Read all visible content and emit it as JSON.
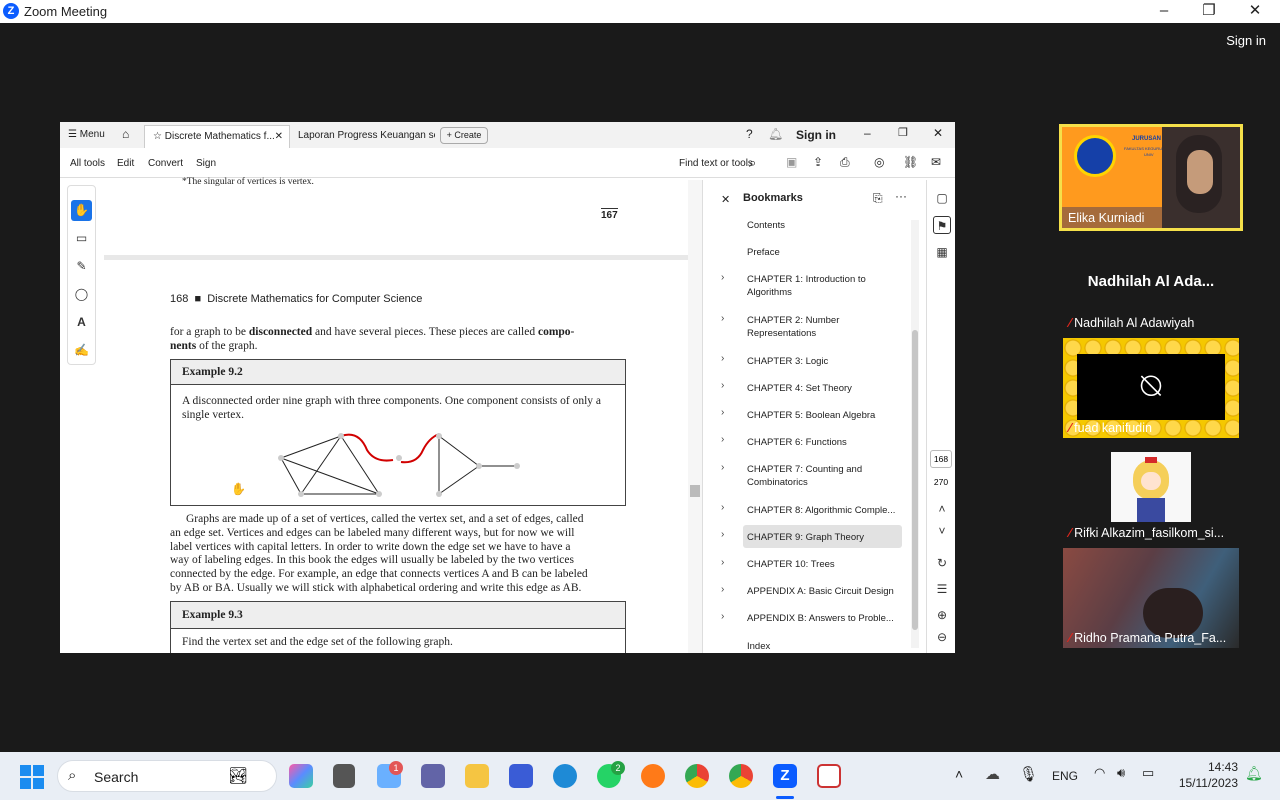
{
  "zoom": {
    "title": "Zoom Meeting",
    "sign_in": "Sign in"
  },
  "acrobat": {
    "tabs": [
      "Menu",
      "Discrete Mathematics f...",
      "Laporan Progress Keuangan ses...",
      "Create"
    ],
    "sign_in": "Sign in",
    "toolbar": [
      "All tools",
      "Edit",
      "Convert",
      "Sign"
    ],
    "find": "Find text or tools",
    "page_current": "168",
    "page_total": "270"
  },
  "doc": {
    "footnote": "*The singular of vertices is vertex.",
    "prev_page_num": "167",
    "header_num": "168",
    "header_title": "Discrete Mathematics for Computer Science",
    "intro_1": "for a graph to be ",
    "intro_bold": "disconnected",
    "intro_2": " and have several pieces. These pieces are called ",
    "intro_bold2": "compo-",
    "intro_line2_bold": "nents",
    "intro_line2": " of the graph.",
    "ex1_title": "Example 9.2",
    "ex1_text": "A disconnected order nine graph with three components. One component consists of only a single vertex.",
    "para_lines": [
      "Graphs are made up of a set of vertices, called the vertex set, and a set of edges, called",
      "an edge set. Vertices and edges can be labeled many different ways, but for now we will",
      "label vertices with capital letters. In order to write down the edge set we have to have a",
      "way of labeling edges. In this book the edges will usually be labeled by the two vertices",
      "connected by the edge. For example, an edge that connects vertices A and B can be labeled",
      "by AB or BA. Usually we will stick with alphabetical ordering and write this edge as AB."
    ],
    "ex2_title": "Example 9.3",
    "ex2_text": "Find the vertex set and the edge set of the following graph."
  },
  "bookmarks": {
    "title": "Bookmarks",
    "items": [
      "Contents",
      "Preface",
      "CHAPTER 1: Introduction to Algorithms",
      "CHAPTER 2: Number Representations",
      "CHAPTER 3: Logic",
      "CHAPTER 4: Set Theory",
      "CHAPTER 5: Boolean Algebra",
      "CHAPTER 6: Functions",
      "CHAPTER 7: Counting and Combinatorics",
      "CHAPTER 8: Algorithmic Comple...",
      "CHAPTER 9: Graph Theory",
      "CHAPTER 10: Trees",
      "APPENDIX A: Basic Circuit Design",
      "APPENDIX B: Answers to Proble...",
      "Index"
    ]
  },
  "participants": [
    {
      "name": "Elika Kurniadi",
      "banner_line1": "JURUSAN PE",
      "banner_line2": "FAKULTAS KEGURU",
      "banner_line3": "UNIV"
    },
    {
      "name": "Nadhilah Al Adawiyah",
      "display": "Nadhilah Al Ada..."
    },
    {
      "name": "fuad kanifudin"
    },
    {
      "name": "Rifki Alkazim_fasilkom_si..."
    },
    {
      "name": "Ridho Pramana Putra_Fa..."
    }
  ],
  "taskbar": {
    "search": "Search",
    "lang": "ENG",
    "time": "14:43",
    "date": "15/11/2023",
    "badge_1": "1",
    "badge_2": "2"
  },
  "colors": {
    "zoom_blue": "#0b5cff",
    "highlight_yellow": "#f5e04a",
    "mic_red": "#e0261d",
    "annotation_red": "#d10000"
  }
}
